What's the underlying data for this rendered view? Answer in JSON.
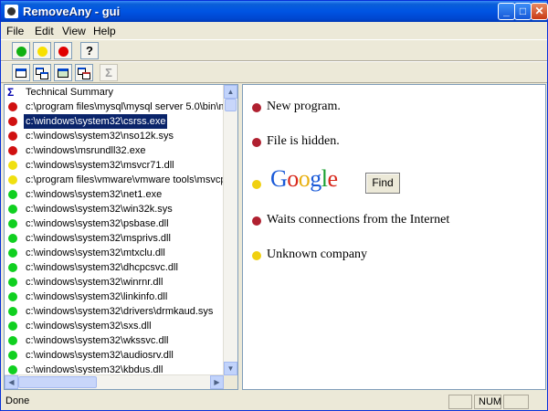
{
  "window": {
    "title": "RemoveAny - gui"
  },
  "menu": [
    "File",
    "Edit",
    "View",
    "Help"
  ],
  "toolbar": {
    "row1_colors": [
      "#10b010",
      "#f8e000",
      "#e00000"
    ],
    "help_glyph": "?",
    "sigma_glyph": "Σ"
  },
  "list": {
    "header": "Technical Summary",
    "items": [
      {
        "path": "c:\\program files\\mysql\\mysql server 5.0\\bin\\m",
        "status": "#d01010",
        "selected": false
      },
      {
        "path": "c:\\windows\\system32\\csrss.exe",
        "status": "#d01010",
        "selected": true
      },
      {
        "path": "c:\\windows\\system32\\nso12k.sys",
        "status": "#d01010",
        "selected": false
      },
      {
        "path": "c:\\windows\\msrundll32.exe",
        "status": "#d01010",
        "selected": false
      },
      {
        "path": "c:\\windows\\system32\\msvcr71.dll",
        "status": "#f0e010",
        "selected": false
      },
      {
        "path": "c:\\program files\\vmware\\vmware tools\\msvcp",
        "status": "#f0e010",
        "selected": false
      },
      {
        "path": "c:\\windows\\system32\\net1.exe",
        "status": "#10d020",
        "selected": false
      },
      {
        "path": "c:\\windows\\system32\\win32k.sys",
        "status": "#10d020",
        "selected": false
      },
      {
        "path": "c:\\windows\\system32\\psbase.dll",
        "status": "#10d020",
        "selected": false
      },
      {
        "path": "c:\\windows\\system32\\msprivs.dll",
        "status": "#10d020",
        "selected": false
      },
      {
        "path": "c:\\windows\\system32\\mtxclu.dll",
        "status": "#10d020",
        "selected": false
      },
      {
        "path": "c:\\windows\\system32\\dhcpcsvc.dll",
        "status": "#10d020",
        "selected": false
      },
      {
        "path": "c:\\windows\\system32\\winrnr.dll",
        "status": "#10d020",
        "selected": false
      },
      {
        "path": "c:\\windows\\system32\\linkinfo.dll",
        "status": "#10d020",
        "selected": false
      },
      {
        "path": "c:\\windows\\system32\\drivers\\drmkaud.sys",
        "status": "#10d020",
        "selected": false
      },
      {
        "path": "c:\\windows\\system32\\sxs.dll",
        "status": "#10d020",
        "selected": false
      },
      {
        "path": "c:\\windows\\system32\\wkssvc.dll",
        "status": "#10d020",
        "selected": false
      },
      {
        "path": "c:\\windows\\system32\\audiosrv.dll",
        "status": "#10d020",
        "selected": false
      },
      {
        "path": "c:\\windows\\system32\\kbdus.dll",
        "status": "#10d020",
        "selected": false
      }
    ]
  },
  "details": {
    "items": [
      {
        "text": "New program.",
        "color": "#b02030"
      },
      {
        "text": "File is hidden.",
        "color": "#b02030"
      },
      {
        "text": "Waits connections from the Internet",
        "color": "#b02030"
      },
      {
        "text": "Unknown company",
        "color": "#f0d010"
      }
    ],
    "google": {
      "logo": "Google",
      "button": "Find",
      "dot_color": "#f0d010"
    }
  },
  "status": {
    "text": "Done",
    "num": "NUM"
  }
}
